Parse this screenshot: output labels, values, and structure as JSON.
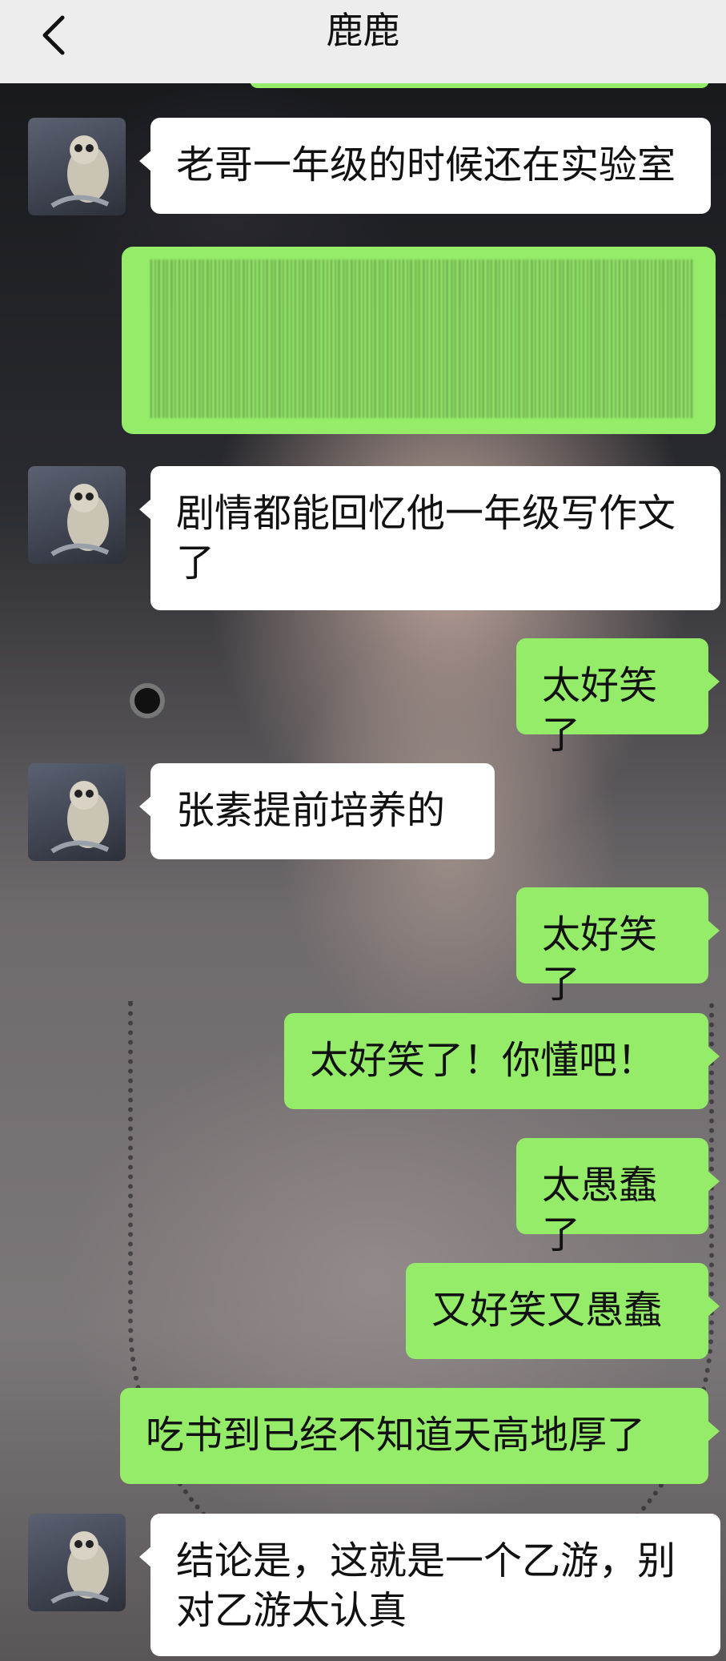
{
  "header": {
    "title": "鹿鹿",
    "back_icon": "chevron-left-icon"
  },
  "colors": {
    "header_bg": "#ededed",
    "sent_bubble": "#95ec69",
    "received_bubble": "#ffffff"
  },
  "messages": [
    {
      "side": "left",
      "text": "老哥一年级的时候还在实验室"
    },
    {
      "side": "right",
      "text": "",
      "censored": true
    },
    {
      "side": "left",
      "text": "剧情都能回忆他一年级写作文了"
    },
    {
      "side": "right",
      "text": "太好笑了"
    },
    {
      "side": "left",
      "text": "张素提前培养的"
    },
    {
      "side": "right",
      "text": "太好笑了"
    },
    {
      "side": "right",
      "text": "太好笑了！你懂吧！"
    },
    {
      "side": "right",
      "text": "太愚蠢了"
    },
    {
      "side": "right",
      "text": "又好笑又愚蠢"
    },
    {
      "side": "right",
      "text": "吃书到已经不知道天高地厚了"
    },
    {
      "side": "left",
      "text": "结论是，这就是一个乙游，别对乙游太认真"
    }
  ]
}
